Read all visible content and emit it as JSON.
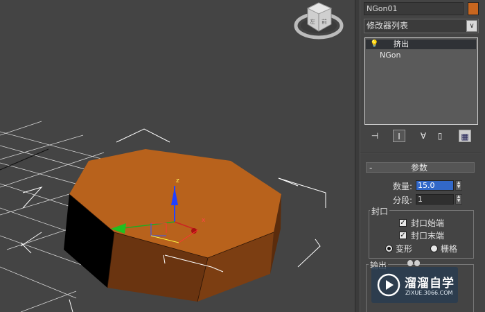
{
  "panel": {
    "object_name": "NGon01",
    "object_color": "#c8661f",
    "modifier_list_label": "修改器列表",
    "dropdown_arrow": "∨",
    "stack": {
      "modifier_item": "挤出",
      "base_item": "NGon"
    },
    "toolbar": {
      "pin_icon": "pin-stack-icon",
      "show_end_icon": "show-end-result-icon",
      "unique_icon": "make-unique-icon",
      "remove_icon": "remove-modifier-icon",
      "configure_icon": "configure-sets-icon"
    },
    "params": {
      "collapse_symbol": "-",
      "title": "参数",
      "amount_label": "数量:",
      "amount_value": "15.0",
      "segments_label": "分段:",
      "segments_value": "1",
      "capping_title": "封口",
      "cap_start_label": "封口始端",
      "cap_start_checked": "✓",
      "cap_end_label": "封口末端",
      "cap_end_checked": "✓",
      "morph_label": "变形",
      "grid_label": "栅格",
      "output_title": "输出"
    }
  },
  "watermark": {
    "brand": "溜溜自学",
    "url": "ZIXUE.3066.COM"
  },
  "viewport": {
    "gizmo_z_label": "z",
    "gizmo_x_label": "x",
    "object_color": "#b8621c"
  }
}
